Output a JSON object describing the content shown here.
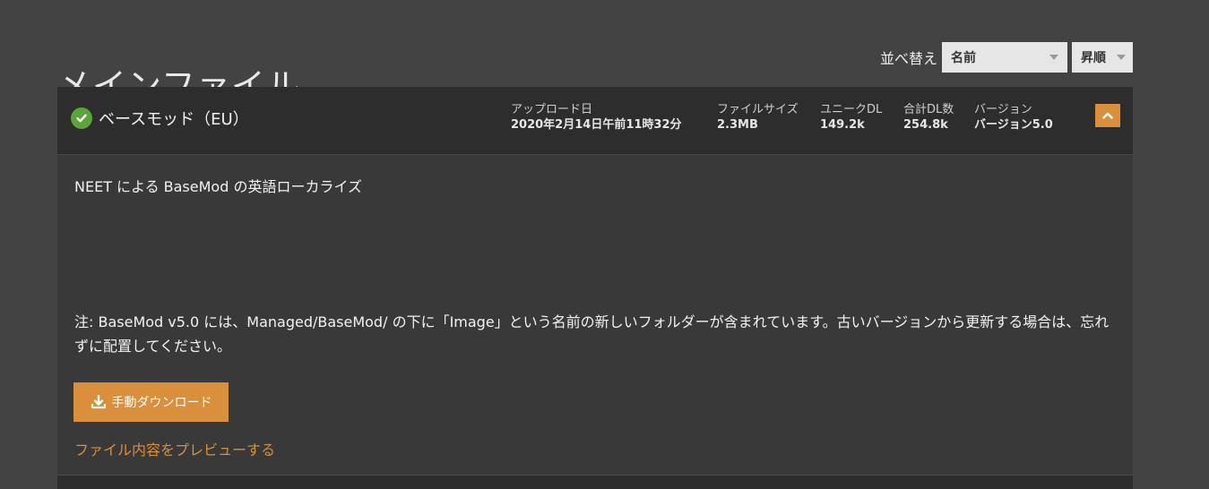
{
  "header": {
    "title": "メインファイル",
    "sort_label": "並べ替え",
    "sort_value": "名前",
    "order_value": "昇順"
  },
  "file": {
    "name": "ベースモッド（EU）",
    "upload_date_label": "アップロード日",
    "upload_date_value": "2020年2月14日午前11時32分",
    "file_size_label": "ファイルサイズ",
    "file_size_value": "2.3MB",
    "unique_dl_label": "ユニークDL",
    "unique_dl_value": "149.2k",
    "total_dl_label": "合計DL数",
    "total_dl_value": "254.8k",
    "version_label": "バージョン",
    "version_value": "バージョン5.0",
    "description": "NEET による BaseMod の英語ローカライズ",
    "note": "注: BaseMod v5.0 には、Managed/BaseMod/ の下に「Image」という名前の新しいフォルダーが含まれています。古いバージョンから更新する場合は、忘れずに配置してください。",
    "download_label": "手動ダウンロード",
    "preview_label": "ファイル内容をプレビューする"
  },
  "icons": {
    "status": "check-circle-icon",
    "collapse": "chevron-up-icon",
    "download": "download-icon"
  },
  "colors": {
    "accent": "#d98f3b",
    "success": "#5aa43a",
    "background": "#434343",
    "card": "#393939",
    "card_header": "#2d2d2d"
  }
}
